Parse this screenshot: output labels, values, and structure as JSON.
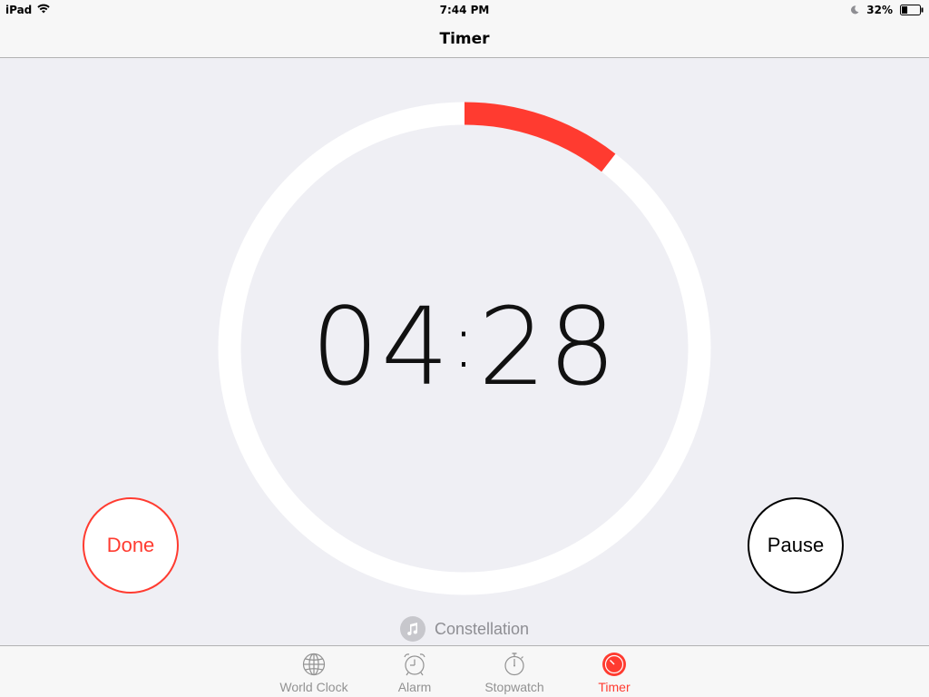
{
  "status_bar": {
    "device": "iPad",
    "time": "7:44 PM",
    "battery_percent": "32%",
    "battery_level": 0.32,
    "icons": [
      "wifi-icon",
      "moon-icon",
      "battery-icon"
    ]
  },
  "nav": {
    "title": "Timer"
  },
  "timer": {
    "display": "04:28",
    "minutes": "04",
    "seconds": "28",
    "separator": ":",
    "progress_fraction": 0.105,
    "progress_color": "#ff3b30",
    "track_color": "#ffffff"
  },
  "buttons": {
    "done_label": "Done",
    "pause_label": "Pause"
  },
  "sound": {
    "name": "Constellation",
    "icon": "music-note-icon"
  },
  "tabs": [
    {
      "label": "World Clock",
      "icon": "globe-icon",
      "active": false
    },
    {
      "label": "Alarm",
      "icon": "alarm-clock-icon",
      "active": false
    },
    {
      "label": "Stopwatch",
      "icon": "stopwatch-icon",
      "active": false
    },
    {
      "label": "Timer",
      "icon": "timer-icon",
      "active": true
    }
  ],
  "colors": {
    "accent": "#ff3b30",
    "background": "#efeff4",
    "inactive_tab": "#929292"
  }
}
